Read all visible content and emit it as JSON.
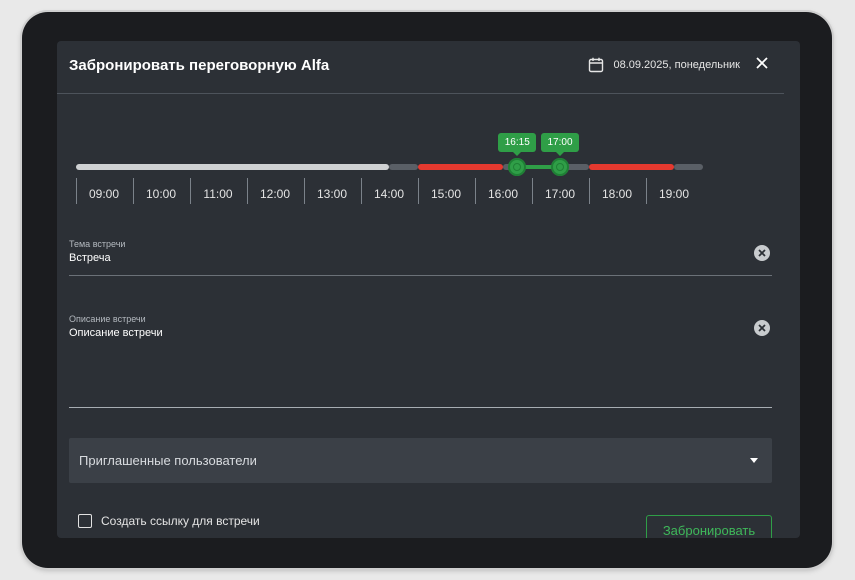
{
  "header": {
    "title": "Забронировать переговорную Alfa",
    "date": "08.09.2025, понедельник",
    "calendar_icon": "calendar-icon",
    "close_icon": "close-icon"
  },
  "timeline": {
    "hours": [
      "09:00",
      "10:00",
      "11:00",
      "12:00",
      "13:00",
      "14:00",
      "15:00",
      "16:00",
      "17:00",
      "18:00",
      "19:00"
    ],
    "selection": {
      "start": "16:15",
      "end": "17:00"
    },
    "segments": [
      {
        "state": "past",
        "color": "#cfd1d3",
        "from": "08:30",
        "to": "14:00"
      },
      {
        "state": "free",
        "color": "#5a5f66",
        "from": "14:00",
        "to": "14:30"
      },
      {
        "state": "busy",
        "color": "#e5392f",
        "from": "14:30",
        "to": "16:00"
      },
      {
        "state": "free",
        "color": "#5a5f66",
        "from": "16:00",
        "to": "16:15"
      },
      {
        "state": "selected",
        "color": "#2f9e47",
        "from": "16:15",
        "to": "17:00"
      },
      {
        "state": "free",
        "color": "#5a5f66",
        "from": "17:00",
        "to": "17:30"
      },
      {
        "state": "busy",
        "color": "#e5392f",
        "from": "17:30",
        "to": "19:00"
      },
      {
        "state": "free",
        "color": "#5a5f66",
        "from": "19:00",
        "to": "19:30"
      }
    ]
  },
  "form": {
    "topic": {
      "label": "Тема встречи",
      "value": "Встреча"
    },
    "description": {
      "label": "Описание встречи",
      "value": "Описание встречи"
    },
    "invited": {
      "placeholder": "Приглашенные пользователи"
    },
    "create_link": {
      "label": "Создать ссылку для встречи",
      "checked": false
    },
    "submit_label": "Забронировать"
  },
  "colors": {
    "accent": "#2f9e47",
    "busy": "#e5392f",
    "background": "#2c3036"
  }
}
